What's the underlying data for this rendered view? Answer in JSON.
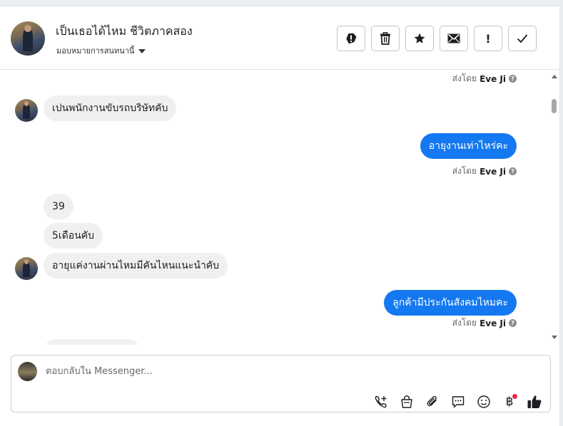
{
  "header": {
    "contact_name": "เป็นเธอได้ไหม ชีวิตภาคสอง",
    "assign_label": "มอบหมายการสนทนานี้"
  },
  "toolbar": {
    "icons": [
      "alert-icon",
      "trash-icon",
      "star-icon",
      "mail-icon",
      "exclamation-icon",
      "check-icon"
    ],
    "exclamation_glyph": "!"
  },
  "messages": [
    {
      "from": "agent",
      "sent_by_prefix": "ส่งโดย",
      "sent_by_name": "Eve Ji",
      "help": "?"
    },
    {
      "from": "customer",
      "text": "เปนพนักงานขับรถบริษัทคับ"
    },
    {
      "from": "agent",
      "text": "อายุงานเท่าไหร่คะ",
      "sent_by_prefix": "ส่งโดย",
      "sent_by_name": "Eve Ji",
      "help": "?"
    },
    {
      "from": "customer",
      "text": "39"
    },
    {
      "from": "customer",
      "text": "5เดือนคับ"
    },
    {
      "from": "customer",
      "text": "อายุแค่งานผ่านไหมมีคันไหนแนะนำคับ"
    },
    {
      "from": "agent",
      "text": "ลูกค้ามีประกันสังคมไหมคะ",
      "sent_by_prefix": "ส่งโดย",
      "sent_by_name": "Eve Ji",
      "help": "?"
    }
  ],
  "composer": {
    "placeholder": "ตอบกลับใน Messenger...",
    "icons": [
      "call-add-icon",
      "shopping-bag-icon",
      "paperclip-icon",
      "chat-bubble-icon",
      "emoji-icon",
      "baht-icon",
      "thumbs-up-icon"
    ],
    "baht_glyph": "฿"
  },
  "colors": {
    "outgoing_bubble": "#1478f0",
    "incoming_bubble": "#f0f0f0",
    "notification_dot": "#f0284a"
  }
}
